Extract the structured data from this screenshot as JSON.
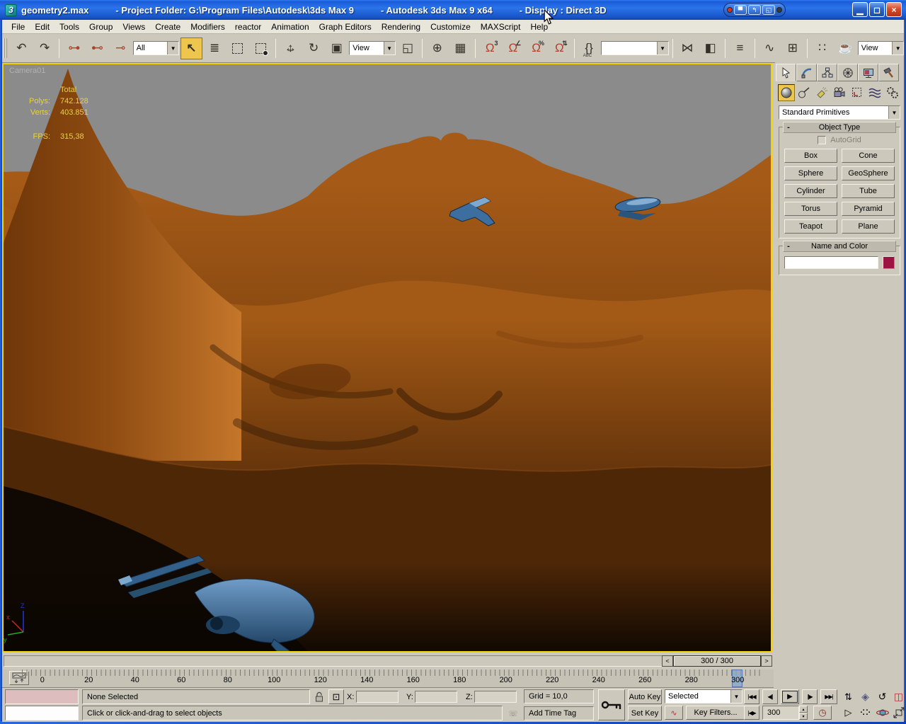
{
  "window": {
    "title_segments": [
      "geometry2.max",
      "- Project Folder: G:\\Program Files\\Autodesk\\3ds Max 9",
      "- Autodesk 3ds Max 9 x64",
      "- Display : Direct 3D"
    ],
    "app_icon_glyph": "3",
    "widget_buttons": [
      "▀",
      "↰",
      "◱"
    ],
    "minimize": "▁",
    "restore": "◻",
    "close": "×"
  },
  "menu": {
    "items": [
      "File",
      "Edit",
      "Tools",
      "Group",
      "Views",
      "Create",
      "Modifiers",
      "reactor",
      "Animation",
      "Graph Editors",
      "Rendering",
      "Customize",
      "MAXScript",
      "Help"
    ]
  },
  "toolbar": {
    "selection_filter_value": "All",
    "reference_coordsys_value": "View",
    "named_selection_value": "",
    "render_type_value": "View",
    "dd_arrow": "▼",
    "icons": {
      "undo": "↶",
      "redo": "↷",
      "link": "⊶",
      "unlink": "⊷",
      "bind_spacewarp": "⊸",
      "select": "↖",
      "select_by_name": "≣",
      "move_h": "↔",
      "move_v": "↕",
      "rotate": "↻",
      "scale": "▣",
      "pivot_center": "◱",
      "manipulate": "⊕",
      "kbd_override": "▦",
      "snap_magnet": "Ω",
      "snap_sup": "3",
      "angle_sup": "∠",
      "percent_sup": "%",
      "spinner_sup": "⇅",
      "named_sets": "{}",
      "named_sets_sub": "ABC",
      "mirror": "⋈",
      "align": "◧",
      "layers": "≡",
      "curve_editor": "∿",
      "schematic_view": "⊞",
      "material_editor": "∷",
      "render_setup": "☕"
    }
  },
  "viewport": {
    "camera_label": "Camera01",
    "stats": {
      "total_header": "Total",
      "polys_label": "Polys:",
      "polys_value": "742.128",
      "verts_label": "Verts:",
      "verts_value": "403.851",
      "fps_label": "FPS:",
      "fps_value": "315,38"
    },
    "axis": {
      "x": "x",
      "y": "y",
      "z": "Z"
    }
  },
  "command_panel": {
    "tabs": [
      "create",
      "modify",
      "hierarchy",
      "motion",
      "display",
      "utilities"
    ],
    "categories": [
      "geometry",
      "shapes",
      "lights",
      "cameras",
      "helpers",
      "space-warps",
      "systems"
    ],
    "category_dropdown_value": "Standard Primitives",
    "object_type": {
      "collapse": "-",
      "title": "Object Type",
      "autogrid_label": "AutoGrid",
      "buttons": [
        "Box",
        "Cone",
        "Sphere",
        "GeoSphere",
        "Cylinder",
        "Tube",
        "Torus",
        "Pyramid",
        "Teapot",
        "Plane"
      ]
    },
    "name_and_color": {
      "collapse": "-",
      "title": "Name and Color",
      "name_value": "",
      "swatch_color": "#9e1243"
    }
  },
  "time_slider": {
    "prev": "<",
    "value": "300 / 300",
    "next": ">"
  },
  "track_bar": {
    "tick_labels": [
      "0",
      "20",
      "40",
      "60",
      "80",
      "100",
      "120",
      "140",
      "160",
      "180",
      "200",
      "220",
      "240",
      "260",
      "280",
      "300"
    ]
  },
  "status": {
    "status_line": "None Selected",
    "prompt_line": "Click or click-and-drag to select objects",
    "x_label": "X:",
    "y_label": "Y:",
    "z_label": "Z:",
    "x_value": "",
    "y_value": "",
    "z_value": "",
    "grid_label": "Grid = 10,0",
    "add_time_tag": "Add Time Tag",
    "auto_key": "Auto Key",
    "set_key": "Set Key",
    "key_filters": "Key Filters...",
    "selected_dropdown_value": "Selected",
    "frame_value": "300",
    "icons": {
      "abs_mode": "⊡",
      "communicator": "☏",
      "tangent_curve": "∿",
      "time_config": "◷",
      "spin_up": "▴",
      "spin_down": "▾",
      "go_start": "|◀◀",
      "prev_frame": "◀||",
      "play": "▶",
      "next_frame": "||▶",
      "go_end": "▶▶|",
      "key_mode": "|◀▶",
      "nav_dolly": "⇅",
      "nav_zoom_extents_all": "◈",
      "nav_roll": "↺",
      "nav_zoom_cube": "◫",
      "nav_fov": "▷",
      "nav_walk": "⠪⠕"
    }
  },
  "colors": {
    "active_button": "#eec64e",
    "viewport_border": "#f3d303",
    "sky": "#8b8b8b",
    "stats_text": "#e8d23c",
    "object_swatch": "#9e1243"
  }
}
